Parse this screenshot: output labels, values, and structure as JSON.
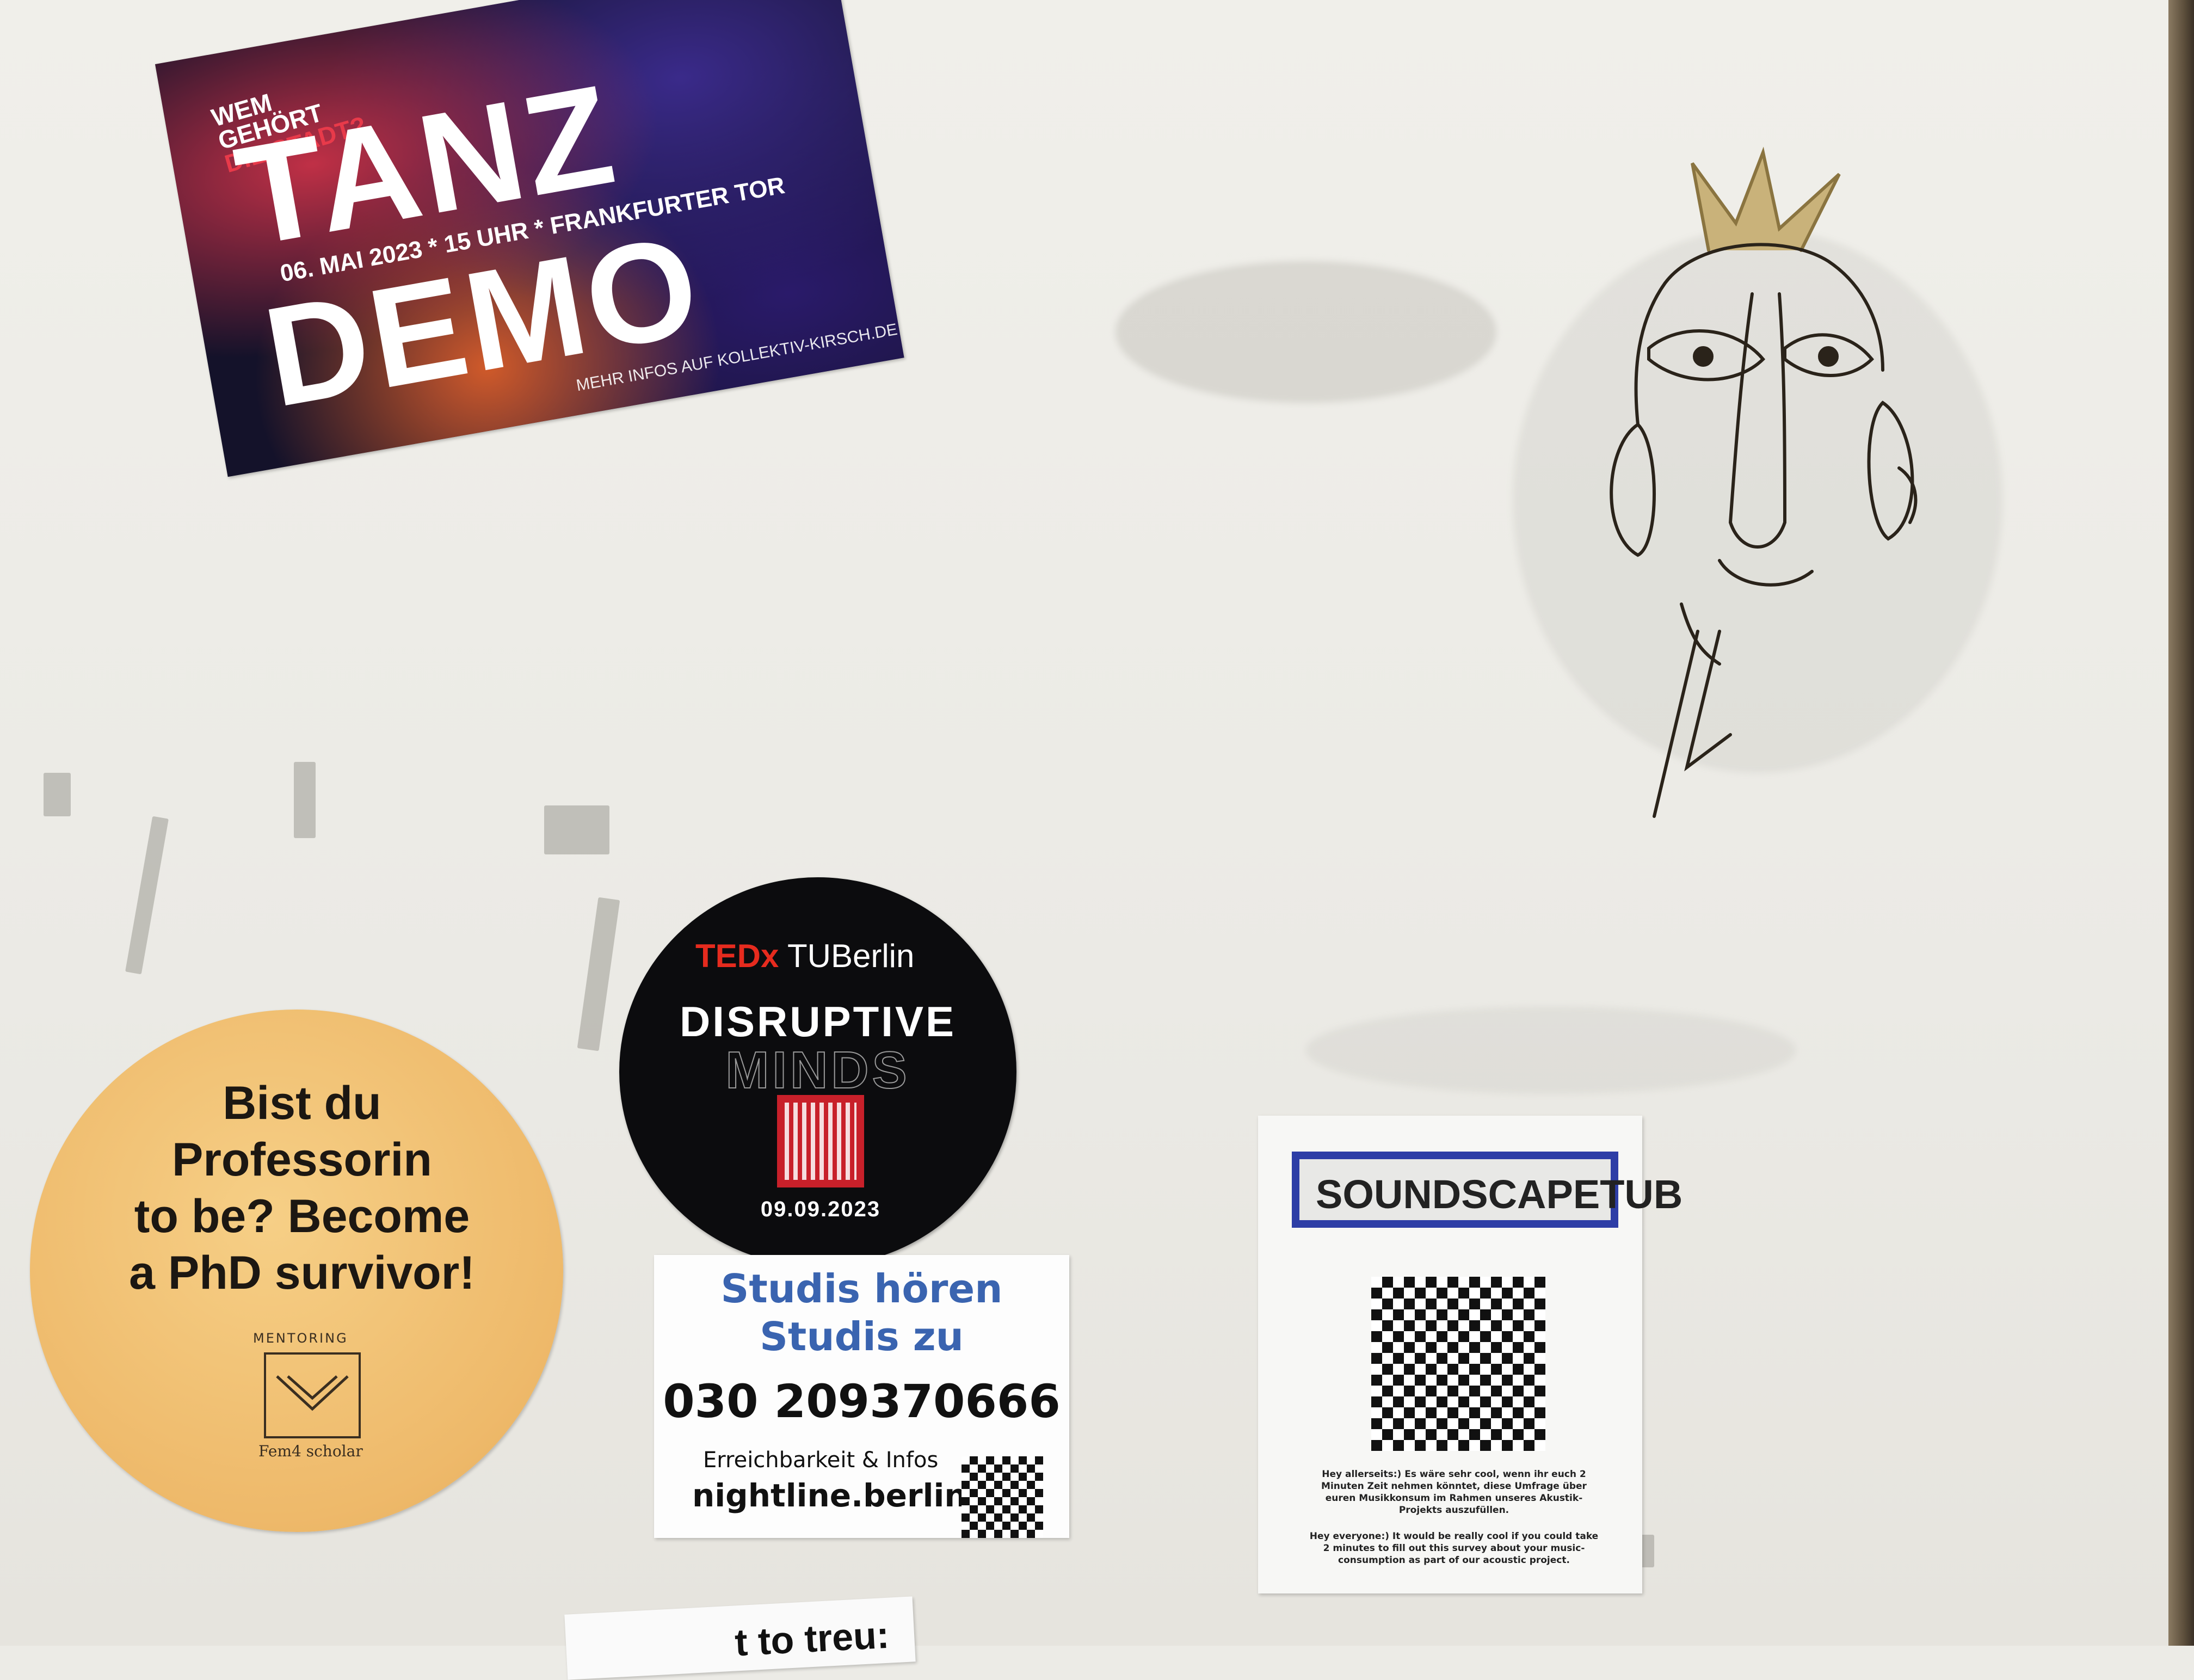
{
  "tanz_demo": {
    "question_line1": "WEM",
    "question_line2": "GEHÖRT",
    "question_line3": "DIE STADT?",
    "title_line1": "TANZ",
    "title_line2": "DEMO",
    "event_info": "06. MAI 2023 * 15 UHR * FRANKFURTER TOR",
    "more_info": "MEHR INFOS AUF KOLLEKTIV-KIRSCH.DE"
  },
  "mentoring_sticker": {
    "line1": "Bist du",
    "line2": "Professorin",
    "line3": "to be? Become",
    "line4": "a PhD survivor!",
    "program_label": "MENTORING",
    "logo_text": "Fem4 scholar"
  },
  "tedx_sticker": {
    "brand": "TEDx",
    "university": "TUBerlin",
    "title_line1": "DISRUPTIVE",
    "title_line2": "MINDS",
    "date": "09.09.2023"
  },
  "nightline_sticker": {
    "line1": "Studis hören",
    "line2": "Studis zu",
    "phone": "030 209370666",
    "availability": "Erreichbarkeit & Infos",
    "website": "nightline.berlin"
  },
  "soundscape_flyer": {
    "title": "SOUNDSCAPETUB",
    "german_text": "Hey allerseits:) Es wäre sehr cool, wenn ihr euch 2 Minuten Zeit nehmen könntet, diese Umfrage über euren Musikkonsum im Rahmen unseres Akustik-Projekts auszufüllen.",
    "english_text": "Hey everyone:) It would be really cool if you could take 2 minutes to fill out this survey about your music-consumption as part of our acoustic project."
  },
  "bottom_sticker": {
    "text": "t to treu:"
  },
  "colors": {
    "wall": "#ecebe6",
    "frame": "#5d4f3c",
    "tedx_red": "#e62b1e",
    "mentoring_yellow": "#eeb96a",
    "nightline_blue": "#3a64b0",
    "soundscape_blue": "#2e3ea6"
  }
}
